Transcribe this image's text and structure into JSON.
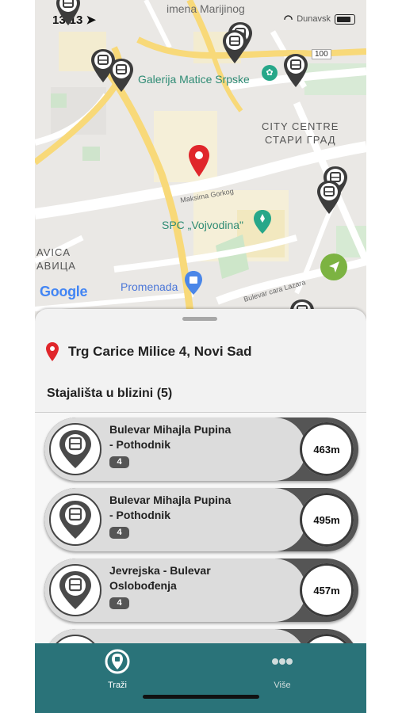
{
  "status_bar": {
    "time": "13:13",
    "carrier_partial": "Dunavsk"
  },
  "map": {
    "labels": {
      "top_street": "imena Marijinog",
      "gallery": "Galerija Matice Srpske",
      "city_centre_latin": "CITY CENTRE",
      "city_centre_cyrillic": "СТАРИ ГРАД",
      "maksima_gorkog": "Maksima Gorkog",
      "spc": "SPC „Vojvodina\"",
      "avica_latin": "AVICA",
      "avica_cyrillic": "АВИЦА",
      "promenada": "Promenada",
      "bulevar_cara_lazara": "Bulevar cara Lazara",
      "road_number": "100",
      "google_logo": "Google"
    },
    "colors": {
      "gallery_text": "#2e8b74",
      "pin_red": "#e0262b"
    }
  },
  "sheet": {
    "address": "Trg Carice Milice 4, Novi Sad",
    "nearby_title": "Stajališta u blizini (5)",
    "stops": [
      {
        "name_line1": "Bulevar Mihajla Pupina",
        "name_line2": "- Pothodnik",
        "badge": "4",
        "distance": "463m"
      },
      {
        "name_line1": "Bulevar Mihajla Pupina",
        "name_line2": "- Pothodnik",
        "badge": "4",
        "distance": "495m"
      },
      {
        "name_line1": "Jevrejska - Bulevar",
        "name_line2": "Oslobođenja",
        "badge": "4",
        "distance": "457m"
      }
    ]
  },
  "tabbar": {
    "tabs": [
      {
        "label": "Traži",
        "icon": "search-stop-icon",
        "active": true
      },
      {
        "label": "Više",
        "icon": "more-dots-icon",
        "active": false
      }
    ],
    "color": "#2a7379"
  }
}
